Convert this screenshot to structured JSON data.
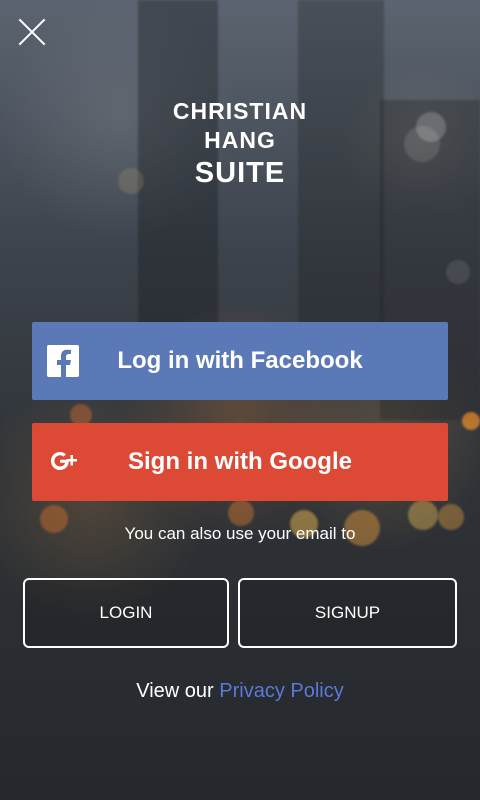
{
  "logo": {
    "line1": "CHRISTIAN",
    "line2": "HANG",
    "line3": "SUITE"
  },
  "buttons": {
    "facebook": "Log in with Facebook",
    "google": "Sign in with Google",
    "login": "LOGIN",
    "signup": "SIGNUP"
  },
  "alt_text": "You can also use your email to",
  "privacy": {
    "prefix": "View our",
    "link": "Privacy Policy"
  },
  "icons": {
    "close": "close-icon",
    "facebook": "facebook-icon",
    "google": "google-plus-icon"
  },
  "colors": {
    "facebook": "#5b79b7",
    "google": "#dc4a36",
    "link": "#5b79d7"
  }
}
